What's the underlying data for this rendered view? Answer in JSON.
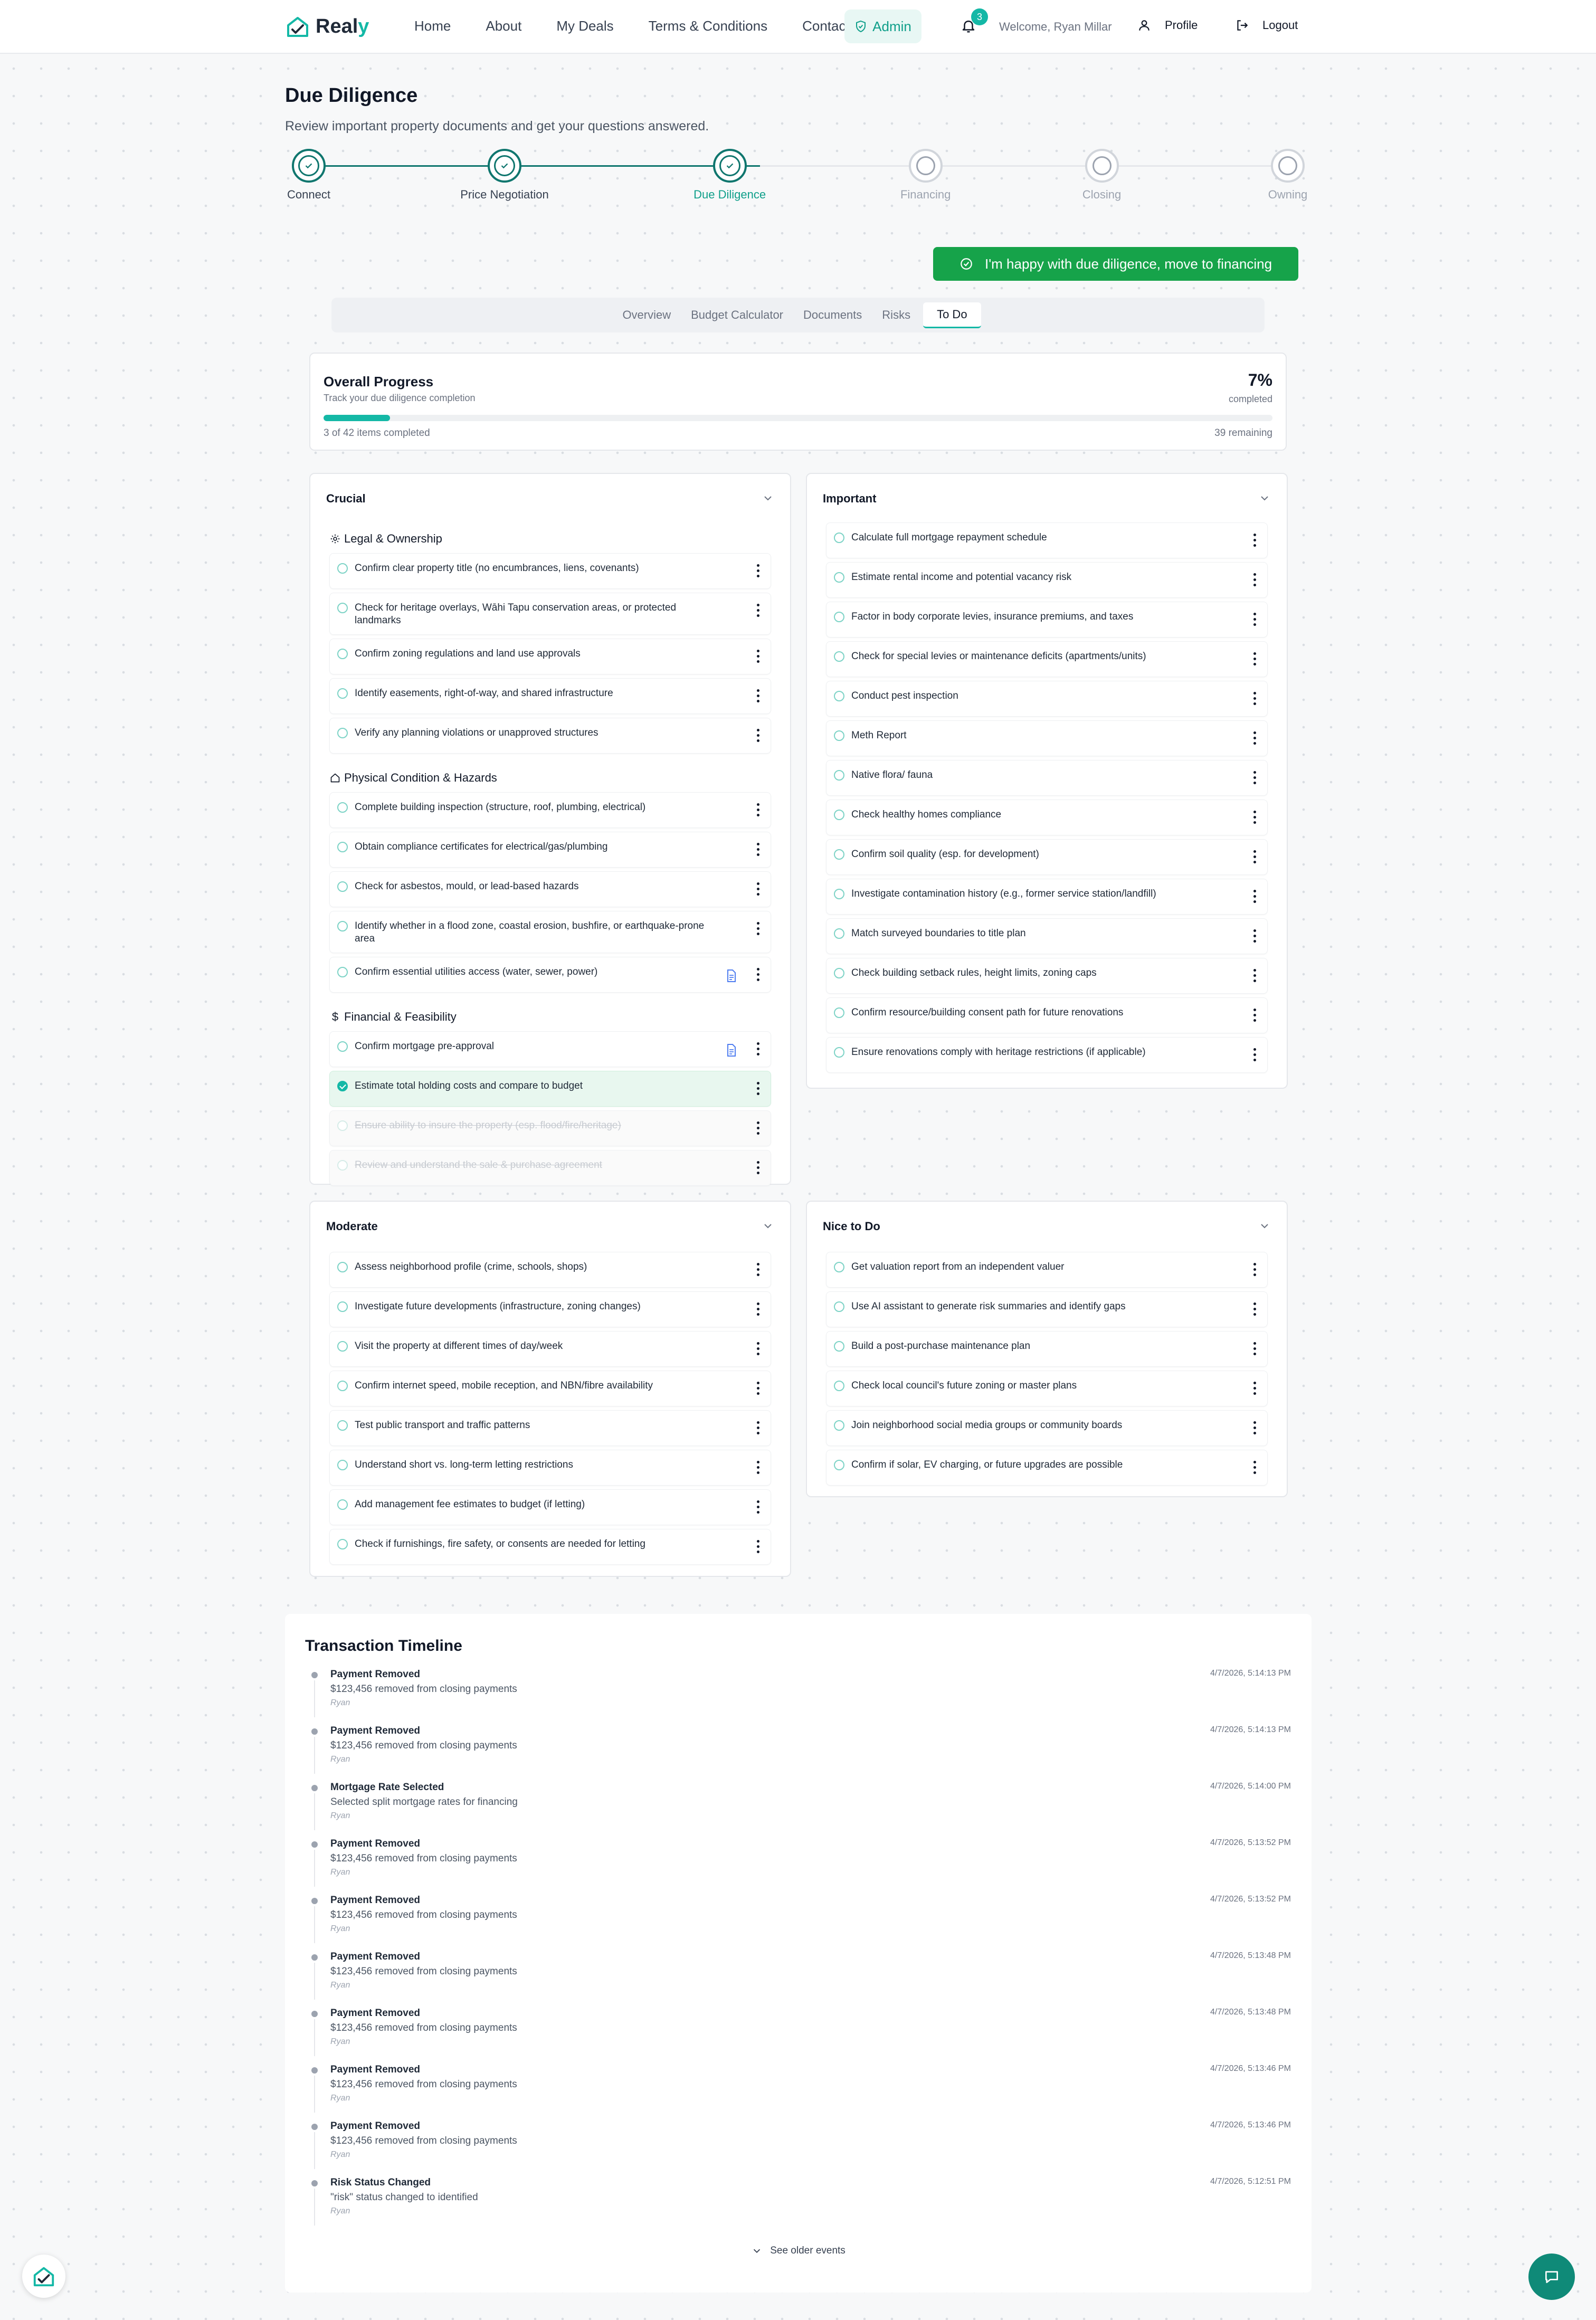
{
  "brand": {
    "name_main": "Real",
    "name_accent": "y"
  },
  "nav": {
    "links": [
      "Home",
      "About",
      "My Deals",
      "Terms & Conditions",
      "Contact"
    ],
    "admin": "Admin",
    "notification_count": "3",
    "welcome": "Welcome, Ryan Millar",
    "profile": "Profile",
    "logout": "Logout"
  },
  "header": {
    "title": "Due Diligence",
    "subtitle": "Review important property documents and get your questions answered."
  },
  "stepper": {
    "steps": [
      {
        "label": "Connect",
        "state": "done"
      },
      {
        "label": "Price Negotiation",
        "state": "done"
      },
      {
        "label": "Due Diligence",
        "state": "active"
      },
      {
        "label": "Financing",
        "state": "pending"
      },
      {
        "label": "Closing",
        "state": "pending"
      },
      {
        "label": "Owning",
        "state": "pending"
      }
    ]
  },
  "cta": {
    "label": "I'm happy with due diligence, move to financing"
  },
  "tabs": {
    "items": [
      "Overview",
      "Budget Calculator",
      "Documents",
      "Risks",
      "To Do"
    ],
    "active": "To Do"
  },
  "progress": {
    "title": "Overall Progress",
    "subtitle": "Track your due diligence completion",
    "percent_label": "7%",
    "completed_label": "completed",
    "fraction": 0.07,
    "items_label": "3 of 42 items completed",
    "remaining_label": "39 remaining"
  },
  "crucial": {
    "title": "Crucial",
    "sections": [
      {
        "name": "Legal & Ownership",
        "icon": "gear-icon",
        "items": [
          {
            "label": "Confirm clear property title (no encumbrances, liens, covenants)"
          },
          {
            "label": "Check for heritage overlays, Wāhi Tapu conservation areas, or protected landmarks"
          },
          {
            "label": "Confirm zoning regulations and land use approvals"
          },
          {
            "label": "Identify easements, right-of-way, and shared infrastructure"
          },
          {
            "label": "Verify any planning violations or unapproved structures"
          }
        ]
      },
      {
        "name": "Physical Condition & Hazards",
        "icon": "home-icon",
        "items": [
          {
            "label": "Complete building inspection (structure, roof, plumbing, electrical)"
          },
          {
            "label": "Obtain compliance certificates for electrical/gas/plumbing"
          },
          {
            "label": "Check for asbestos, mould, or lead-based hazards"
          },
          {
            "label": "Identify whether in a flood zone, coastal erosion, bushfire, or earthquake-prone area"
          },
          {
            "label": "Confirm essential utilities access (water, sewer, power)",
            "doc": true
          }
        ]
      },
      {
        "name": "Financial & Feasibility",
        "icon": "dollar-icon",
        "items": [
          {
            "label": "Confirm mortgage pre-approval",
            "doc": true
          },
          {
            "label": "Estimate total holding costs and compare to budget",
            "state": "checked"
          },
          {
            "label": "Ensure ability to insure the property (esp. flood/fire/heritage)",
            "state": "struck"
          },
          {
            "label": "Review and understand the sale & purchase agreement",
            "state": "struck"
          }
        ]
      }
    ]
  },
  "important": {
    "title": "Important",
    "items": [
      {
        "label": "Calculate full mortgage repayment schedule"
      },
      {
        "label": "Estimate rental income and potential vacancy risk"
      },
      {
        "label": "Factor in body corporate levies, insurance premiums, and taxes"
      },
      {
        "label": "Check for special levies or maintenance deficits (apartments/units)"
      },
      {
        "label": "Conduct pest inspection"
      },
      {
        "label": "Meth Report"
      },
      {
        "label": "Native flora/ fauna"
      },
      {
        "label": "Check healthy homes compliance"
      },
      {
        "label": "Confirm soil quality (esp. for development)"
      },
      {
        "label": "Investigate contamination history (e.g., former service station/landfill)"
      },
      {
        "label": "Match surveyed boundaries to title plan"
      },
      {
        "label": "Check building setback rules, height limits, zoning caps"
      },
      {
        "label": "Confirm resource/building consent path for future renovations"
      },
      {
        "label": "Ensure renovations comply with heritage restrictions (if applicable)"
      }
    ]
  },
  "moderate": {
    "title": "Moderate",
    "items": [
      {
        "label": "Assess neighborhood profile (crime, schools, shops)"
      },
      {
        "label": "Investigate future developments (infrastructure, zoning changes)"
      },
      {
        "label": "Visit the property at different times of day/week"
      },
      {
        "label": "Confirm internet speed, mobile reception, and NBN/fibre availability"
      },
      {
        "label": "Test public transport and traffic patterns"
      },
      {
        "label": "Understand short vs. long-term letting restrictions"
      },
      {
        "label": "Add management fee estimates to budget (if letting)"
      },
      {
        "label": "Check if furnishings, fire safety, or consents are needed for letting"
      }
    ]
  },
  "nice": {
    "title": "Nice to Do",
    "items": [
      {
        "label": "Get valuation report from an independent valuer"
      },
      {
        "label": "Use AI assistant to generate risk summaries and identify gaps"
      },
      {
        "label": "Build a post-purchase maintenance plan"
      },
      {
        "label": "Check local council's future zoning or master plans"
      },
      {
        "label": "Join neighborhood social media groups or community boards"
      },
      {
        "label": "Confirm if solar, EV charging, or future upgrades are possible"
      }
    ]
  },
  "timeline": {
    "title": "Transaction Timeline",
    "events": [
      {
        "title": "Payment Removed",
        "desc": "$123,456 removed from closing payments",
        "user": "Ryan",
        "time": "4/7/2026, 5:14:13 PM"
      },
      {
        "title": "Payment Removed",
        "desc": "$123,456 removed from closing payments",
        "user": "Ryan",
        "time": "4/7/2026, 5:14:13 PM"
      },
      {
        "title": "Mortgage Rate Selected",
        "desc": "Selected split mortgage rates for financing",
        "user": "Ryan",
        "time": "4/7/2026, 5:14:00 PM"
      },
      {
        "title": "Payment Removed",
        "desc": "$123,456 removed from closing payments",
        "user": "Ryan",
        "time": "4/7/2026, 5:13:52 PM"
      },
      {
        "title": "Payment Removed",
        "desc": "$123,456 removed from closing payments",
        "user": "Ryan",
        "time": "4/7/2026, 5:13:52 PM"
      },
      {
        "title": "Payment Removed",
        "desc": "$123,456 removed from closing payments",
        "user": "Ryan",
        "time": "4/7/2026, 5:13:48 PM"
      },
      {
        "title": "Payment Removed",
        "desc": "$123,456 removed from closing payments",
        "user": "Ryan",
        "time": "4/7/2026, 5:13:48 PM"
      },
      {
        "title": "Payment Removed",
        "desc": "$123,456 removed from closing payments",
        "user": "Ryan",
        "time": "4/7/2026, 5:13:46 PM"
      },
      {
        "title": "Payment Removed",
        "desc": "$123,456 removed from closing payments",
        "user": "Ryan",
        "time": "4/7/2026, 5:13:46 PM"
      },
      {
        "title": "Risk Status Changed",
        "desc": "\"risk\" status changed to identified",
        "user": "Ryan",
        "time": "4/7/2026, 5:12:51 PM"
      }
    ],
    "see_older": "See older events"
  },
  "colors": {
    "accent": "#14b8a6",
    "cta": "#16a34a",
    "stepper_done": "#0f766e",
    "chat_fab": "#0f8a78"
  }
}
